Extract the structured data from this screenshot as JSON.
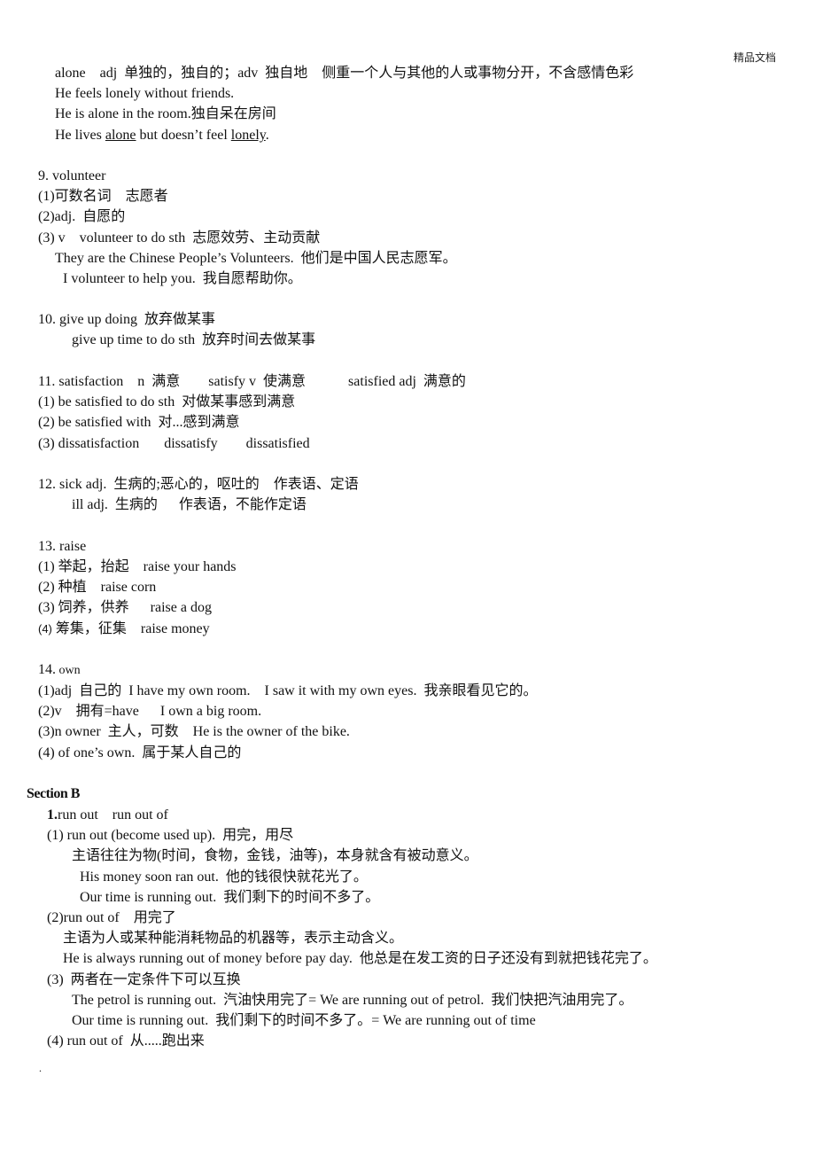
{
  "watermark": "精品文档",
  "alone_block": {
    "line1": "alone    adj  单独的，独自的；adv  独自地    侧重一个人与其他的人或事物分开，不含感情色彩",
    "line2": "He feels lonely without friends.",
    "line3": "He is alone in the room.独自呆在房间",
    "line4_pre": "He lives ",
    "line4_u1": "alone",
    "line4_mid": " but doesn’t feel ",
    "line4_u2": "lonely",
    "line4_post": "."
  },
  "item9": {
    "title": "9. volunteer",
    "l1": "(1)可数名词    志愿者",
    "l2": "(2)adj.  自愿的",
    "l3": "(3) v    volunteer to do sth  志愿效劳、主动贡献",
    "ex1": "They are the Chinese People’s Volunteers.  他们是中国人民志愿军。",
    "ex2": "I volunteer to help you.  我自愿帮助你。"
  },
  "item10": {
    "title": "10. give up doing  放弃做某事",
    "l1": "give up time to do sth  放弃时间去做某事"
  },
  "item11": {
    "title": "11. satisfaction    n  满意        satisfy v  使满意            satisfied adj  满意的",
    "l1": "(1) be satisfied to do sth  对做某事感到满意",
    "l2": "(2) be satisfied with  对...感到满意",
    "l3": "(3) dissatisfaction       dissatisfy        dissatisfied"
  },
  "item12": {
    "title": "12. sick adj.  生病的;恶心的，呕吐的    作表语、定语",
    "l1": "ill adj.  生病的      作表语，不能作定语"
  },
  "item13": {
    "title": "13. raise",
    "l1": "(1) 举起，抬起    raise your hands",
    "l2": "(2) 种植    raise corn",
    "l3": "(3) 饲养，供养      raise a dog",
    "l4_num": "(4)",
    "l4_text": " 筹集，征集    raise money"
  },
  "item14": {
    "title_num": "14.",
    "title_word": " own",
    "l1": "(1)adj  自己的  I have my own room.    I saw it with my own eyes.  我亲眼看见它的。",
    "l2": "(2)v    拥有=have      I own a big room.",
    "l3": "(3)n owner  主人，可数    He is the owner of the bike.",
    "l4": "(4) of one’s own.  属于某人自己的"
  },
  "sectionB": {
    "title": "Section B",
    "item1_num": "1.",
    "item1_title": "run out    run out of",
    "p1": "(1) run out (become used up).  用完，用尽",
    "p1_note": "主语往往为物(时间，食物，金钱，油等)，本身就含有被动意义。",
    "p1_ex1": "His money soon ran out.  他的钱很快就花光了。",
    "p1_ex2": "Our time is running out.  我们剩下的时间不多了。",
    "p2": "(2)run out of    用完了",
    "p2_note": "主语为人或某种能消耗物品的机器等，表示主动含义。",
    "p2_ex1": "He is always running out of money before pay day.  他总是在发工资的日子还没有到就把钱花完了。",
    "p3": "(3)  两者在一定条件下可以互换",
    "p3_ex1": "The petrol is running out.  汽油快用完了= We are running out of petrol.  我们快把汽油用完了。",
    "p3_ex2": "Our time is running out.  我们剩下的时间不多了。= We are running out of time",
    "p4": "(4) run out of  从.....跑出来"
  },
  "footer_dot": "."
}
